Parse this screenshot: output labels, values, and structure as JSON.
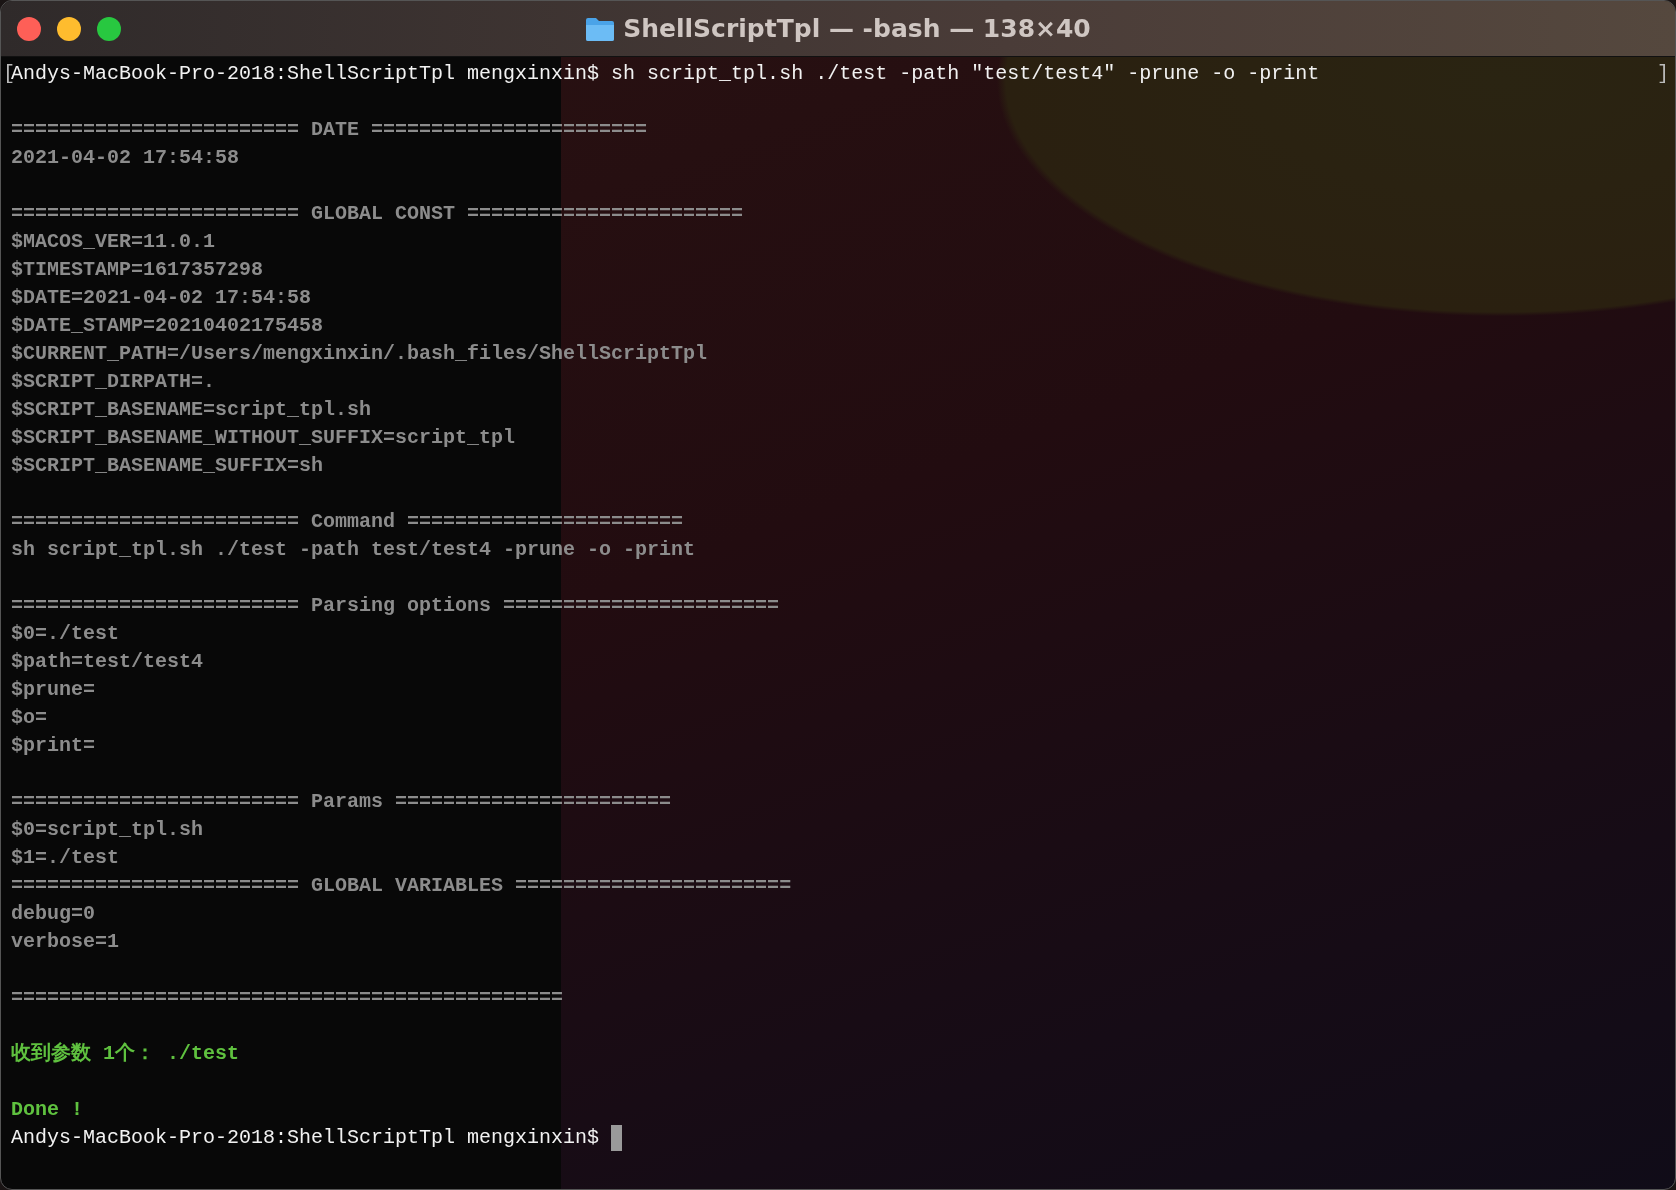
{
  "window": {
    "title": "ShellScriptTpl — -bash — 138×40"
  },
  "marks": {
    "left": "[",
    "right": "]"
  },
  "lines": [
    {
      "kind": "prompt",
      "text": "Andys-MacBook-Pro-2018:ShellScriptTpl mengxinxin$ sh script_tpl.sh ./test -path \"test/test4\" -prune -o -print",
      "cursor": false
    },
    {
      "kind": "blank"
    },
    {
      "kind": "output",
      "text": "======================== DATE ======================="
    },
    {
      "kind": "output",
      "text": "2021-04-02 17:54:58"
    },
    {
      "kind": "blank"
    },
    {
      "kind": "output",
      "text": "======================== GLOBAL CONST ======================="
    },
    {
      "kind": "output",
      "text": "$MACOS_VER=11.0.1"
    },
    {
      "kind": "output",
      "text": "$TIMESTAMP=1617357298"
    },
    {
      "kind": "output",
      "text": "$DATE=2021-04-02 17:54:58"
    },
    {
      "kind": "output",
      "text": "$DATE_STAMP=20210402175458"
    },
    {
      "kind": "output",
      "text": "$CURRENT_PATH=/Users/mengxinxin/.bash_files/ShellScriptTpl"
    },
    {
      "kind": "output",
      "text": "$SCRIPT_DIRPATH=."
    },
    {
      "kind": "output",
      "text": "$SCRIPT_BASENAME=script_tpl.sh"
    },
    {
      "kind": "output",
      "text": "$SCRIPT_BASENAME_WITHOUT_SUFFIX=script_tpl"
    },
    {
      "kind": "output",
      "text": "$SCRIPT_BASENAME_SUFFIX=sh"
    },
    {
      "kind": "blank"
    },
    {
      "kind": "output",
      "text": "======================== Command ======================="
    },
    {
      "kind": "output",
      "text": "sh script_tpl.sh ./test -path test/test4 -prune -o -print"
    },
    {
      "kind": "blank"
    },
    {
      "kind": "output",
      "text": "======================== Parsing options ======================="
    },
    {
      "kind": "output",
      "text": "$0=./test"
    },
    {
      "kind": "output",
      "text": "$path=test/test4"
    },
    {
      "kind": "output",
      "text": "$prune="
    },
    {
      "kind": "output",
      "text": "$o="
    },
    {
      "kind": "output",
      "text": "$print="
    },
    {
      "kind": "blank"
    },
    {
      "kind": "output",
      "text": "======================== Params ======================="
    },
    {
      "kind": "output",
      "text": "$0=script_tpl.sh"
    },
    {
      "kind": "output",
      "text": "$1=./test"
    },
    {
      "kind": "output",
      "text": "======================== GLOBAL VARIABLES ======================="
    },
    {
      "kind": "output",
      "text": "debug=0"
    },
    {
      "kind": "output",
      "text": "verbose=1"
    },
    {
      "kind": "blank"
    },
    {
      "kind": "output",
      "text": "=============================================="
    },
    {
      "kind": "blank"
    },
    {
      "kind": "success",
      "text": "收到参数 1个： ./test"
    },
    {
      "kind": "blank"
    },
    {
      "kind": "success",
      "text": "Done !"
    },
    {
      "kind": "prompt",
      "text": "Andys-MacBook-Pro-2018:ShellScriptTpl mengxinxin$ ",
      "cursor": true
    }
  ]
}
